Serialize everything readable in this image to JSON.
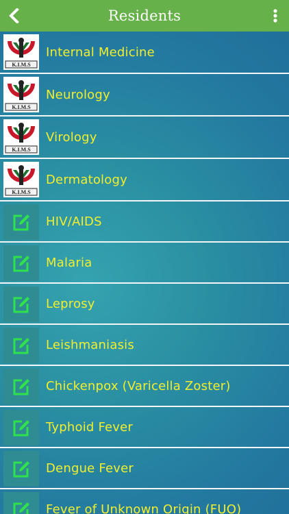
{
  "header": {
    "title": "Residents",
    "bg_color": "#67b14a"
  },
  "list_items": [
    {
      "label": "Internal Medicine",
      "icon": "kims-logo-icon"
    },
    {
      "label": "Neurology",
      "icon": "kims-logo-icon"
    },
    {
      "label": "Virology",
      "icon": "kims-logo-icon"
    },
    {
      "label": "Dermatology",
      "icon": "kims-logo-icon"
    },
    {
      "label": "HIV/AIDS",
      "icon": "edit-icon"
    },
    {
      "label": "Malaria",
      "icon": "edit-icon"
    },
    {
      "label": "Leprosy",
      "icon": "edit-icon"
    },
    {
      "label": "Leishmaniasis",
      "icon": "edit-icon"
    },
    {
      "label": "Chickenpox (Varicella Zoster)",
      "icon": "edit-icon"
    },
    {
      "label": "Typhoid Fever",
      "icon": "edit-icon"
    },
    {
      "label": "Dengue Fever",
      "icon": "edit-icon"
    },
    {
      "label": "Fever of Unknown Origin (FUO)",
      "icon": "edit-icon"
    }
  ],
  "logo_text": "K.I.M.S",
  "colors": {
    "label_text": "#f3ef2c",
    "edit_icon_green": "#2de24b",
    "separator": "#f2f6f8"
  }
}
